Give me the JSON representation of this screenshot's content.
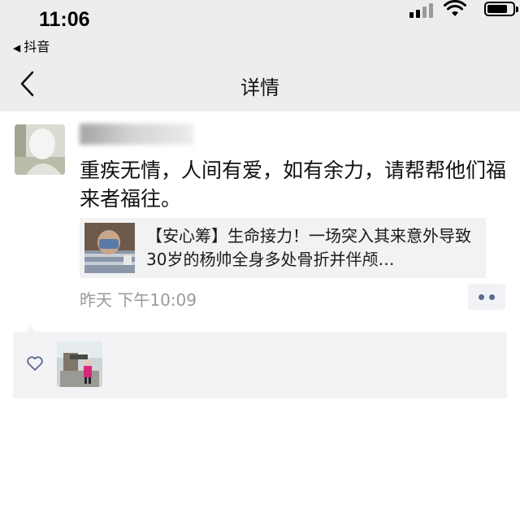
{
  "status_bar": {
    "time": "11:06",
    "back_app_label": "抖音"
  },
  "nav": {
    "title": "详情"
  },
  "post": {
    "text": "重疾无情，人间有爱，如有余力，请帮帮他们福来者福往。",
    "link_card": {
      "title": "【安心筹】生命接力！一场突入其来意外导致30岁的杨帅全身多处骨折并伴颅…"
    },
    "timestamp": "昨天 下午10:09"
  },
  "colors": {
    "header_bg": "#ededed",
    "link_card_bg": "#f2f2f2",
    "likes_bg": "#f3f3f5",
    "accent_blue_grey": "#5a6a8c",
    "timestamp": "#9a9a9a"
  },
  "icons": {
    "back": "chevron-left-icon",
    "heart": "heart-outline-icon",
    "more": "more-dots-icon",
    "signal": "signal-icon",
    "wifi": "wifi-icon",
    "battery": "battery-icon"
  }
}
